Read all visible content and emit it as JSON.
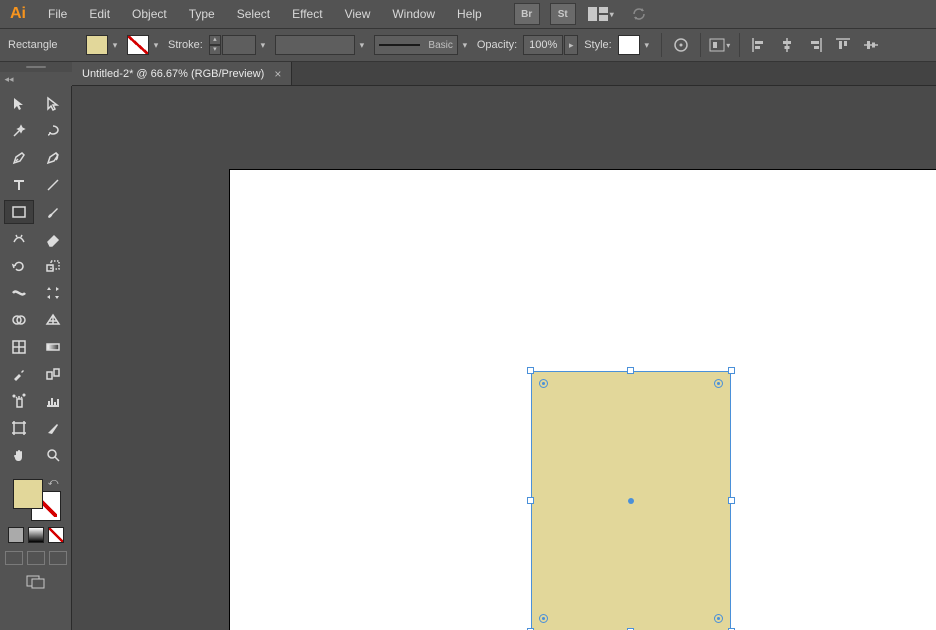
{
  "app": {
    "logo_text": "Ai"
  },
  "menu": {
    "items": [
      "File",
      "Edit",
      "Object",
      "Type",
      "Select",
      "Effect",
      "View",
      "Window",
      "Help"
    ],
    "bridge": "Br",
    "stock": "St"
  },
  "control": {
    "selection_label": "Rectangle",
    "stroke_label": "Stroke:",
    "brush_label": "Basic",
    "opacity_label": "Opacity:",
    "opacity_value": "100%",
    "style_label": "Style:",
    "fill_color": "#e2d79a",
    "stroke_color": "none"
  },
  "document": {
    "tab_title": "Untitled-2* @ 66.67% (RGB/Preview)"
  },
  "tools": {
    "names": [
      "selection-tool",
      "direct-selection-tool",
      "magic-wand-tool",
      "lasso-tool",
      "pen-tool",
      "curvature-tool",
      "type-tool",
      "line-segment-tool",
      "rectangle-tool",
      "paintbrush-tool",
      "shaper-tool",
      "eraser-tool",
      "rotate-tool",
      "scale-tool",
      "width-tool",
      "free-transform-tool",
      "shape-builder-tool",
      "perspective-grid-tool",
      "mesh-tool",
      "gradient-tool",
      "eyedropper-tool",
      "blend-tool",
      "symbol-sprayer-tool",
      "column-graph-tool",
      "artboard-tool",
      "slice-tool",
      "hand-tool",
      "zoom-tool"
    ],
    "active": "rectangle-tool"
  },
  "canvas": {
    "selected_shape": "Rectangle",
    "shape_fill": "#e2d79a"
  }
}
